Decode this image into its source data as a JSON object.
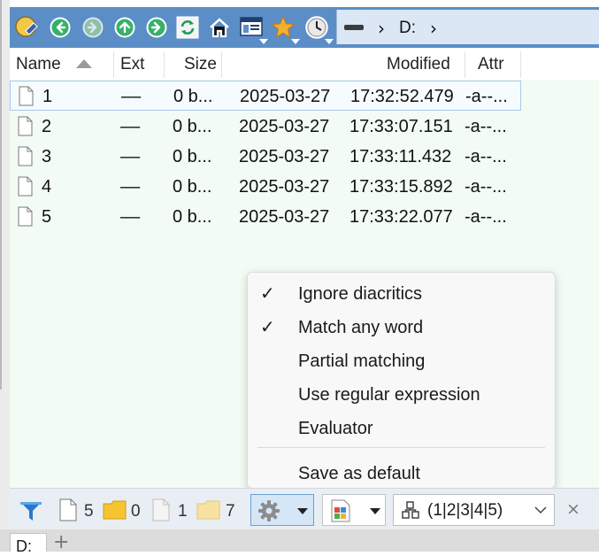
{
  "toolbar": {
    "icons": [
      "app-logo-icon",
      "back-icon",
      "forward-icon",
      "up-icon",
      "go-icon",
      "refresh-icon",
      "home-icon",
      "layout-icon",
      "favorites-icon",
      "history-icon"
    ],
    "address": {
      "drive_icon": "drive-icon",
      "separator": "›",
      "path": "D:"
    }
  },
  "columns": {
    "name": "Name",
    "ext": "Ext",
    "size": "Size",
    "modified": "Modified",
    "attr": "Attr"
  },
  "files": [
    {
      "name": "1",
      "ext": "––",
      "size": "0 b...",
      "date": "2025-03-27",
      "time": "17:32:52.479",
      "attr": "-a--..."
    },
    {
      "name": "2",
      "ext": "––",
      "size": "0 b...",
      "date": "2025-03-27",
      "time": "17:33:07.151",
      "attr": "-a--..."
    },
    {
      "name": "3",
      "ext": "––",
      "size": "0 b...",
      "date": "2025-03-27",
      "time": "17:33:11.432",
      "attr": "-a--..."
    },
    {
      "name": "4",
      "ext": "––",
      "size": "0 b...",
      "date": "2025-03-27",
      "time": "17:33:15.892",
      "attr": "-a--..."
    },
    {
      "name": "5",
      "ext": "––",
      "size": "0 b...",
      "date": "2025-03-27",
      "time": "17:33:22.077",
      "attr": "-a--..."
    }
  ],
  "menu": {
    "items": [
      {
        "label": "Ignore diacritics",
        "checked": "✓"
      },
      {
        "label": "Match any word",
        "checked": "✓"
      },
      {
        "label": "Partial matching",
        "checked": ""
      },
      {
        "label": "Use regular expression",
        "checked": ""
      },
      {
        "label": "Evaluator",
        "checked": ""
      }
    ],
    "save_default": "Save as default"
  },
  "status": {
    "files_count": "5",
    "folders_count": "0",
    "hidden_files_count": "1",
    "hidden_folders_count": "7",
    "pattern": "(1|2|3|4|5)",
    "close": "×"
  },
  "tabs": {
    "current": "D:",
    "add": "+"
  },
  "colors": {
    "toolbar": "#5b8ec7",
    "list_bg": "#f2fcf4",
    "accent": "#6d9fd3"
  }
}
